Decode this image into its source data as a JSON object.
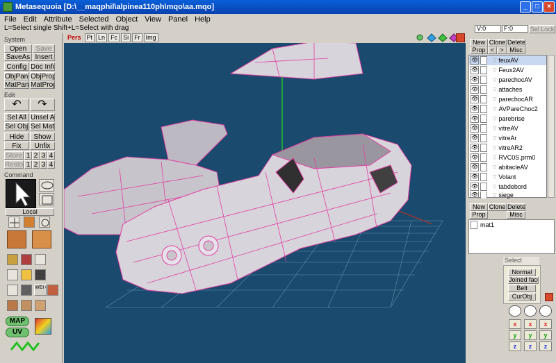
{
  "window": {
    "title": "Metasequoia [D:\\__maqphil\\alpinea110ph\\mqo\\aa.mqo]",
    "minimize": "_",
    "maximize": "□",
    "close": "×"
  },
  "menu": [
    "File",
    "Edit",
    "Attribute",
    "Selected",
    "Object",
    "View",
    "Panel",
    "Help"
  ],
  "hint": "L=Select single  Shift+L=Select with drag",
  "counters": {
    "vertex": "V:0",
    "face": "F:0",
    "sel_lock": "Sel Lock"
  },
  "system": {
    "label": "System",
    "buttons": [
      "Open",
      "Save",
      "SaveAs",
      "Insert",
      "Config",
      "Doc Info",
      "ObjPane",
      "ObjProp",
      "MatPane",
      "MatProp"
    ]
  },
  "edit": {
    "label": "Edit",
    "undo": "↶",
    "redo": "↷",
    "buttons": [
      "Sel All",
      "Unsel All",
      "Sel Obj",
      "Sel Mat",
      "Hide",
      "Show",
      "Fix",
      "Unfix"
    ],
    "store": "Store",
    "restore": "Restore",
    "slots": [
      "1",
      "2",
      "3",
      "4"
    ]
  },
  "command": {
    "label": "Command",
    "local": "Local",
    "map": "MAP",
    "uv": "UV",
    "weight": "WEI GHT"
  },
  "viewtabs": [
    "Pers",
    "Pt",
    "Ln",
    "Fc",
    "Si",
    "Fr",
    "Img"
  ],
  "objects": {
    "buttons": [
      "New",
      "Clone",
      "Delete",
      "Prop",
      "<",
      ">",
      "Misc"
    ],
    "items": [
      "feuxAV",
      "Feux2AV",
      "parechocAV",
      "attaches",
      "parechocAR",
      "AVPareChoc2",
      "parebrise",
      "vitreAV",
      "vitreAr",
      "vitreAR2",
      "RVC0S.prm0",
      "abitacleAV",
      "Volant",
      "tabdebord",
      "siege"
    ],
    "selected_index": 0
  },
  "materials": {
    "buttons": [
      "New",
      "Clone",
      "Delete",
      "Prop",
      "Misc"
    ],
    "items": [
      "mat1"
    ]
  },
  "select_panel": {
    "title": "Select",
    "options": [
      "Normal",
      "Joined face",
      "Belt",
      "CurObj"
    ],
    "selected": "Normal"
  },
  "axes": {
    "x": "x",
    "y": "y",
    "z": "z"
  },
  "colors": {
    "viewport_bg": "#1a4a6d",
    "mesh_wire": "#e040a0",
    "mesh_face": "#d8d4dc",
    "grid": "#7fb0c8",
    "titlebar": "#0a5fd8"
  }
}
